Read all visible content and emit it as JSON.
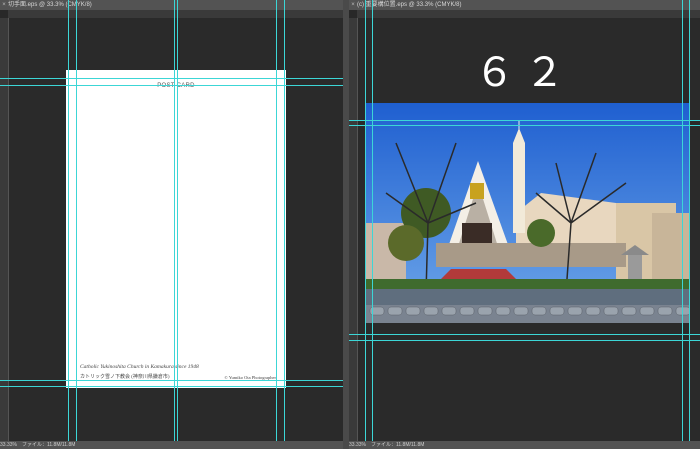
{
  "left_document": {
    "tab_title": "切手面.eps @ 33.3% (CMYK/8)",
    "status": "33.33%　ファイル：11.8M/11.8M",
    "postcard": {
      "title": "POST CARD",
      "caption_en": "Catholic Yukinoshita Church in Kamakura since 1948",
      "caption_ja": "カトリック雪ノ下教会 (神奈川県鎌倉市)",
      "credit": "© Yumiko Ota Photographer"
    }
  },
  "right_document": {
    "tab_title": "(c) 重要構位置.eps @ 33.3% (CMYK/8)",
    "page_number": "６２",
    "status": "33.33%　ファイル：11.8M/11.8M"
  },
  "colors": {
    "workspace": "#282828",
    "panel": "#535353",
    "guide": "#3cd6d6",
    "sky": "#2f6fd6"
  },
  "icons": [
    "close-icon",
    "close-icon"
  ]
}
